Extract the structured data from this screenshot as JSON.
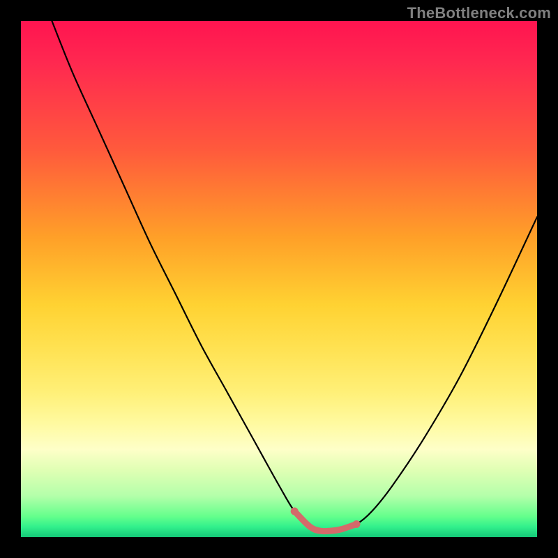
{
  "watermark": "TheBottleneck.com",
  "chart_data": {
    "type": "line",
    "title": "",
    "xlabel": "",
    "ylabel": "",
    "xlim": [
      0,
      100
    ],
    "ylim": [
      0,
      100
    ],
    "grid": false,
    "series": [
      {
        "name": "curve",
        "color": "#000000",
        "x": [
          6,
          10,
          15,
          20,
          25,
          30,
          35,
          40,
          45,
          50,
          53,
          56,
          58,
          60,
          62,
          65,
          68,
          72,
          78,
          85,
          92,
          100
        ],
        "values": [
          100,
          90,
          79,
          68,
          57,
          47,
          37,
          28,
          19,
          10,
          5,
          2,
          1.2,
          1.2,
          1.5,
          2.5,
          5,
          10,
          19,
          31,
          45,
          62
        ]
      },
      {
        "name": "optimal-zone",
        "color": "#d46a6a",
        "x": [
          53,
          56,
          58,
          60,
          62,
          65
        ],
        "values": [
          5,
          2,
          1.2,
          1.2,
          1.5,
          2.5
        ]
      }
    ],
    "background_gradient": {
      "top": "#ff1450",
      "mid": "#ffd232",
      "bottom": "#14c878"
    }
  }
}
